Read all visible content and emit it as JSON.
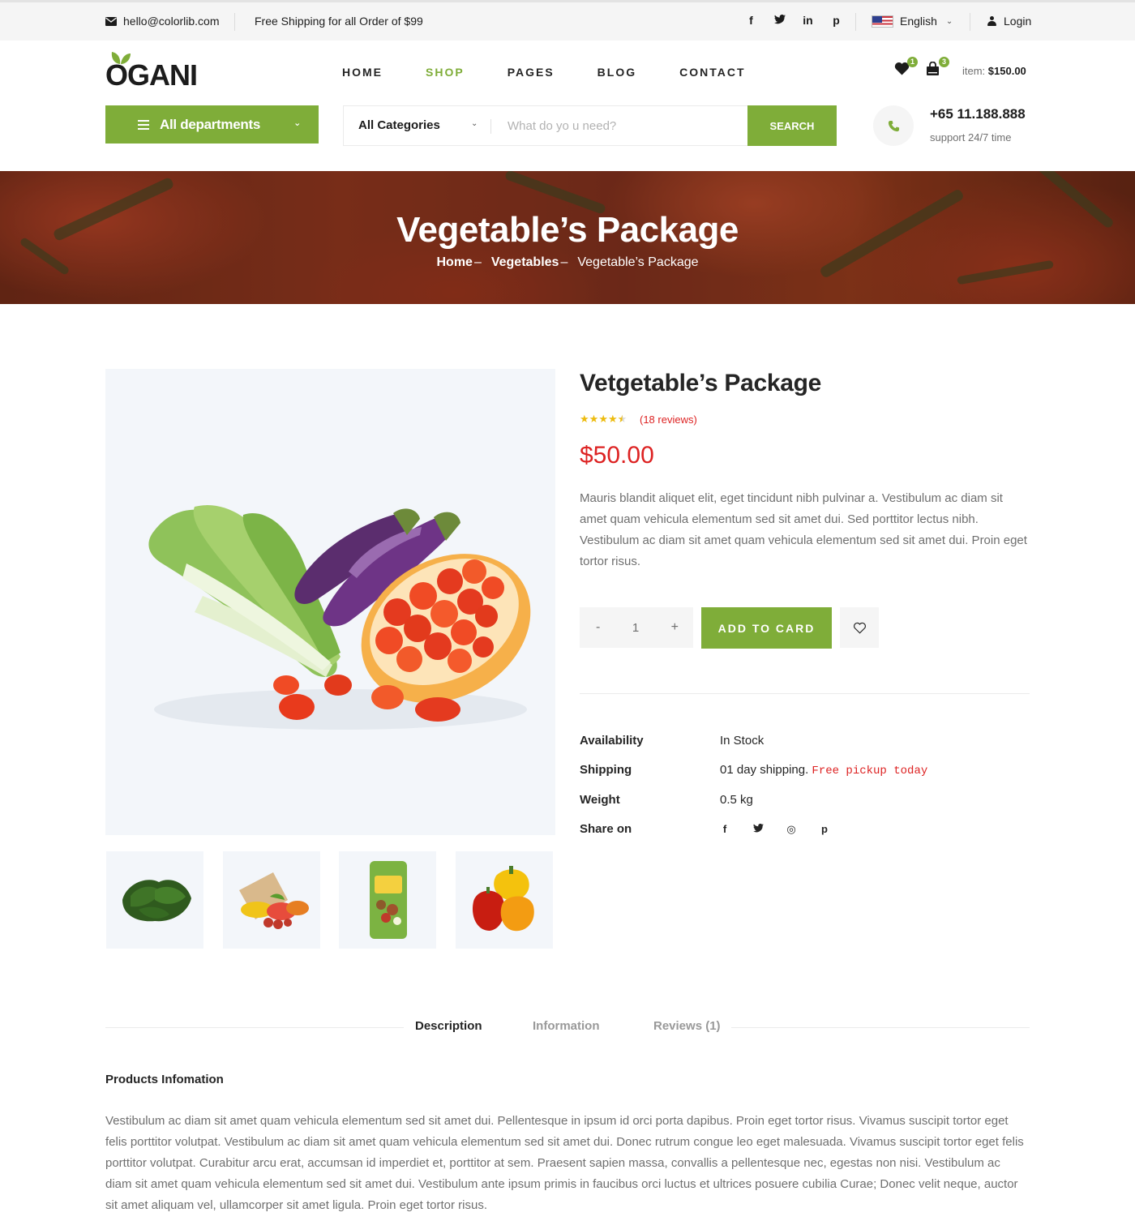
{
  "topbar": {
    "email": "hello@colorlib.com",
    "shipping_note": "Free Shipping for all Order of $99",
    "social_icons": [
      "facebook-icon",
      "twitter-icon",
      "linkedin-icon",
      "pinterest-icon"
    ],
    "social_glyphs": [
      "f",
      "t",
      "in",
      "p"
    ],
    "language": "English",
    "login": "Login"
  },
  "header": {
    "logo": "OGANI",
    "nav": [
      "HOME",
      "SHOP",
      "PAGES",
      "BLOG",
      "CONTACT"
    ],
    "active_nav": "SHOP",
    "wishlist_count": "1",
    "cart_count": "3",
    "cart_label": "item:",
    "cart_total": "$150.00"
  },
  "search": {
    "departments_label": "All departments",
    "category": "All Categories",
    "placeholder": "What do yo u need?",
    "button": "SEARCH",
    "phone": "+65 11.188.888",
    "support": "support 24/7 time"
  },
  "hero": {
    "title": "Vegetable’s Package",
    "breadcrumb": [
      "Home",
      "Vegetables",
      "Vegetable’s Package"
    ]
  },
  "product": {
    "title": "Vetgetable’s Package",
    "rating": 4.5,
    "rating_max": 5,
    "reviews": "(18 reviews)",
    "price": "$50.00",
    "description": "Mauris blandit aliquet elit, eget tincidunt nibh pulvinar a. Vestibulum ac diam sit amet quam vehicula elementum sed sit amet dui. Sed porttitor lectus nibh. Vestibulum ac diam sit amet quam vehicula elementum sed sit amet dui. Proin eget tortor risus.",
    "qty_minus": "-",
    "quantity": "1",
    "qty_plus": "+",
    "add_button": "ADD TO CARD",
    "specs": {
      "availability_label": "Availability",
      "availability": "In Stock",
      "shipping_label": "Shipping",
      "shipping": "01 day shipping.",
      "shipping_extra": "Free pickup today",
      "weight_label": "Weight",
      "weight": "0.5 kg",
      "share_label": "Share on"
    },
    "share_icons": [
      "facebook-icon",
      "twitter-icon",
      "instagram-icon",
      "pinterest-icon"
    ],
    "share_glyphs": [
      "f",
      "t",
      "◎",
      "p"
    ],
    "thumbnails": [
      "spinach",
      "grocery-bag",
      "fruit-and-more-pack",
      "bell-peppers"
    ]
  },
  "tabs": {
    "items": [
      "Description",
      "Information",
      "Reviews (1)"
    ],
    "active": "Description",
    "section_title": "Products Infomation",
    "body": "Vestibulum ac diam sit amet quam vehicula elementum sed sit amet dui. Pellentesque in ipsum id orci porta dapibus. Proin eget tortor risus. Vivamus suscipit tortor eget felis porttitor volutpat. Vestibulum ac diam sit amet quam vehicula elementum sed sit amet dui. Donec rutrum congue leo eget malesuada. Vivamus suscipit tortor eget felis porttitor volutpat. Curabitur arcu erat, accumsan id imperdiet et, porttitor at sem. Praesent sapien massa, convallis a pellentesque nec, egestas non nisi. Vestibulum ac diam sit amet quam vehicula elementum sed sit amet dui. Vestibulum ante ipsum primis in faucibus orci luctus et ultrices posuere cubilia Curae; Donec velit neque, auctor sit amet aliquam vel, ullamcorper sit amet ligula. Proin eget tortor risus."
  },
  "colors": {
    "brand_green": "#7fad39",
    "price_red": "#dd2222",
    "star_yellow": "#edbb0e"
  }
}
